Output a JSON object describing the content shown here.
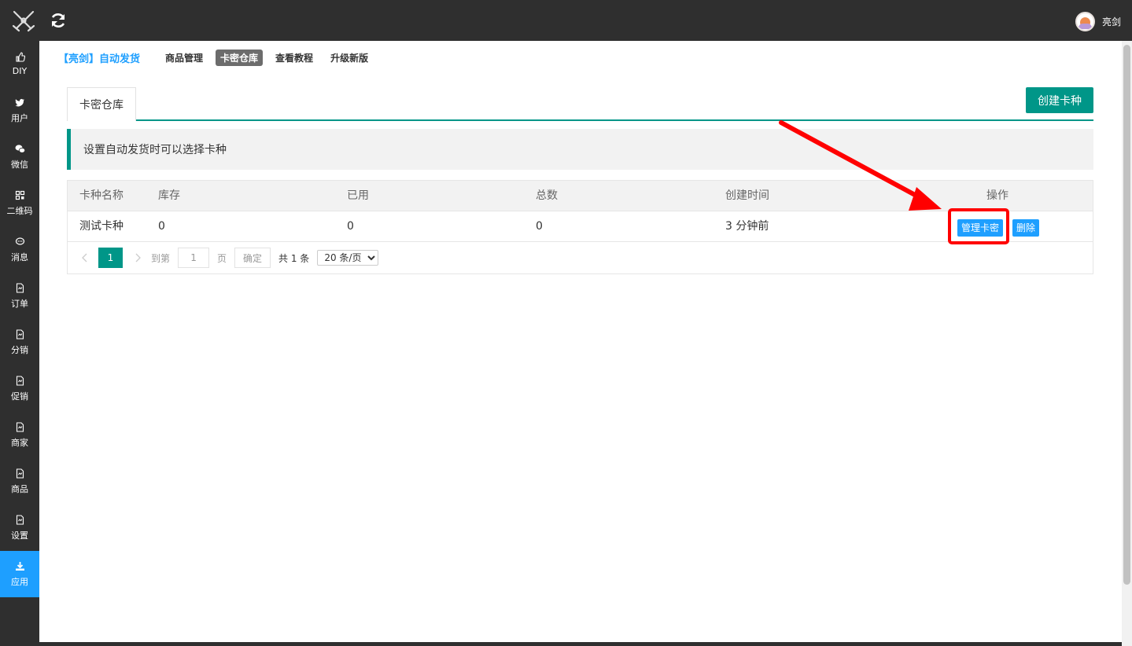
{
  "topbar": {
    "logo_icon": "crossed-swords-icon",
    "refresh_icon": "refresh-icon",
    "user_name": "亮剑"
  },
  "sidebar": {
    "items": [
      {
        "label": "DIY",
        "icon": "thumbs-up-icon",
        "active": false
      },
      {
        "label": "用户",
        "icon": "twitter-bird-icon",
        "active": false
      },
      {
        "label": "微信",
        "icon": "wechat-icon",
        "active": false
      },
      {
        "label": "二维码",
        "icon": "qrcode-icon",
        "active": false
      },
      {
        "label": "消息",
        "icon": "chat-bubble-icon",
        "active": false
      },
      {
        "label": "订单",
        "icon": "document-icon",
        "active": false
      },
      {
        "label": "分销",
        "icon": "document-icon",
        "active": false
      },
      {
        "label": "促销",
        "icon": "document-icon",
        "active": false
      },
      {
        "label": "商家",
        "icon": "document-icon",
        "active": false
      },
      {
        "label": "商品",
        "icon": "document-icon",
        "active": false
      },
      {
        "label": "设置",
        "icon": "document-icon",
        "active": false
      },
      {
        "label": "应用",
        "icon": "download-icon",
        "active": true
      }
    ]
  },
  "subnav": {
    "brand": "【亮剑】自动发货",
    "links": [
      "商品管理",
      "卡密仓库",
      "查看教程",
      "升级新版"
    ],
    "active_link": "卡密仓库"
  },
  "tabs": {
    "active_tab": "卡密仓库",
    "create_button": "创建卡种"
  },
  "tip": {
    "text": "设置自动发货时可以选择卡种"
  },
  "table": {
    "headers": [
      "卡种名称",
      "库存",
      "已用",
      "总数",
      "创建时间",
      "操作"
    ],
    "rows": [
      {
        "name": "测试卡种",
        "stock": "0",
        "used": "0",
        "total": "0",
        "created": "3 分钟前"
      }
    ],
    "action_manage": "管理卡密",
    "action_delete": "删除"
  },
  "pagination": {
    "current_page": "1",
    "goto_label": "到第",
    "goto_value": "1",
    "page_unit": "页",
    "confirm_label": "确定",
    "total_text": "共 1 条",
    "page_size": "20 条/页"
  },
  "colors": {
    "dark_bg": "#2f2f2f",
    "accent_blue": "#1e9fff",
    "accent_teal": "#009688",
    "annotation_red": "#ff0000"
  }
}
